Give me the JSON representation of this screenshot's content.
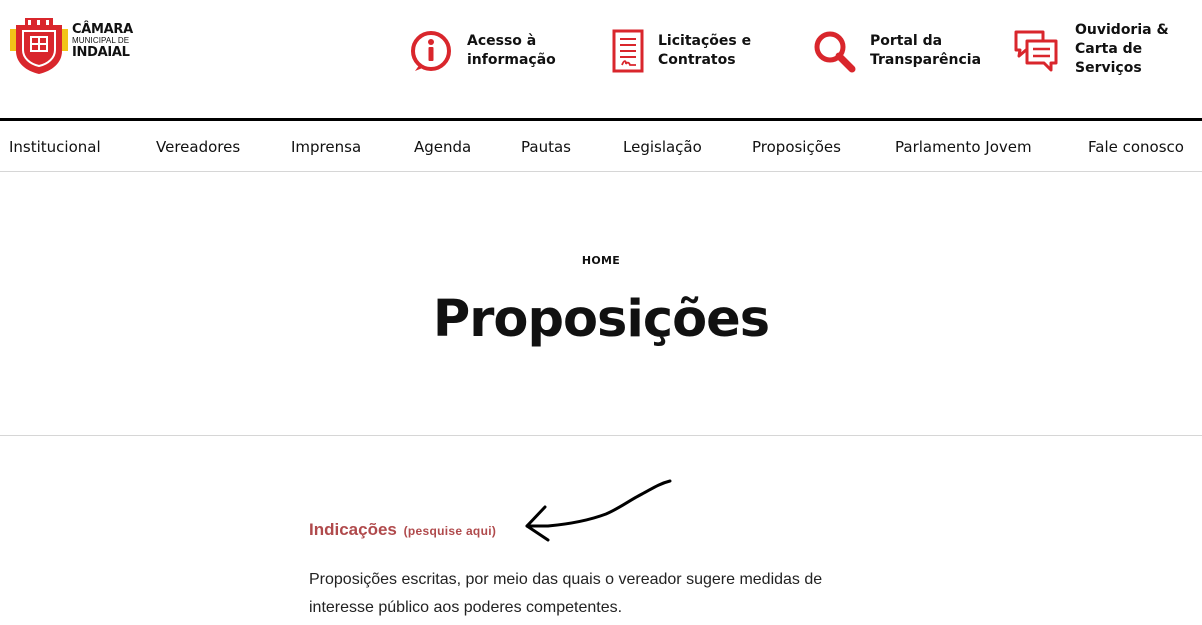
{
  "brand": {
    "line1": "CÂMARA",
    "line2": "MUNICIPAL DE",
    "line3": "INDAIAL",
    "colors": {
      "red": "#d9262c",
      "yellow": "#f2c418"
    }
  },
  "quick_links": [
    {
      "line1": "Acesso à",
      "line2": "informação",
      "icon": "info-icon"
    },
    {
      "line1": "Licitações e",
      "line2": "Contratos",
      "icon": "document-icon"
    },
    {
      "line1": "Portal da",
      "line2": "Transparência",
      "icon": "search-icon"
    },
    {
      "line1": "Ouvidoria &",
      "line2": "Carta de",
      "line3": "Serviços",
      "icon": "chat-icon"
    }
  ],
  "nav": {
    "items": [
      {
        "label": "Institucional"
      },
      {
        "label": "Vereadores"
      },
      {
        "label": "Imprensa"
      },
      {
        "label": "Agenda"
      },
      {
        "label": "Pautas"
      },
      {
        "label": "Legislação"
      },
      {
        "label": "Proposições"
      },
      {
        "label": "Parlamento Jovem"
      },
      {
        "label": "Fale conosco"
      }
    ]
  },
  "breadcrumb": {
    "home": "HOME"
  },
  "page": {
    "title": "Proposições"
  },
  "section": {
    "heading": "Indicações",
    "heading_sub": "(pesquise aqui)",
    "text": "Proposições escritas, por meio das quais o vereador sugere medidas de interesse público aos poderes competentes."
  },
  "accent_color": "#d9262c",
  "heading_color": "#b04a4c"
}
